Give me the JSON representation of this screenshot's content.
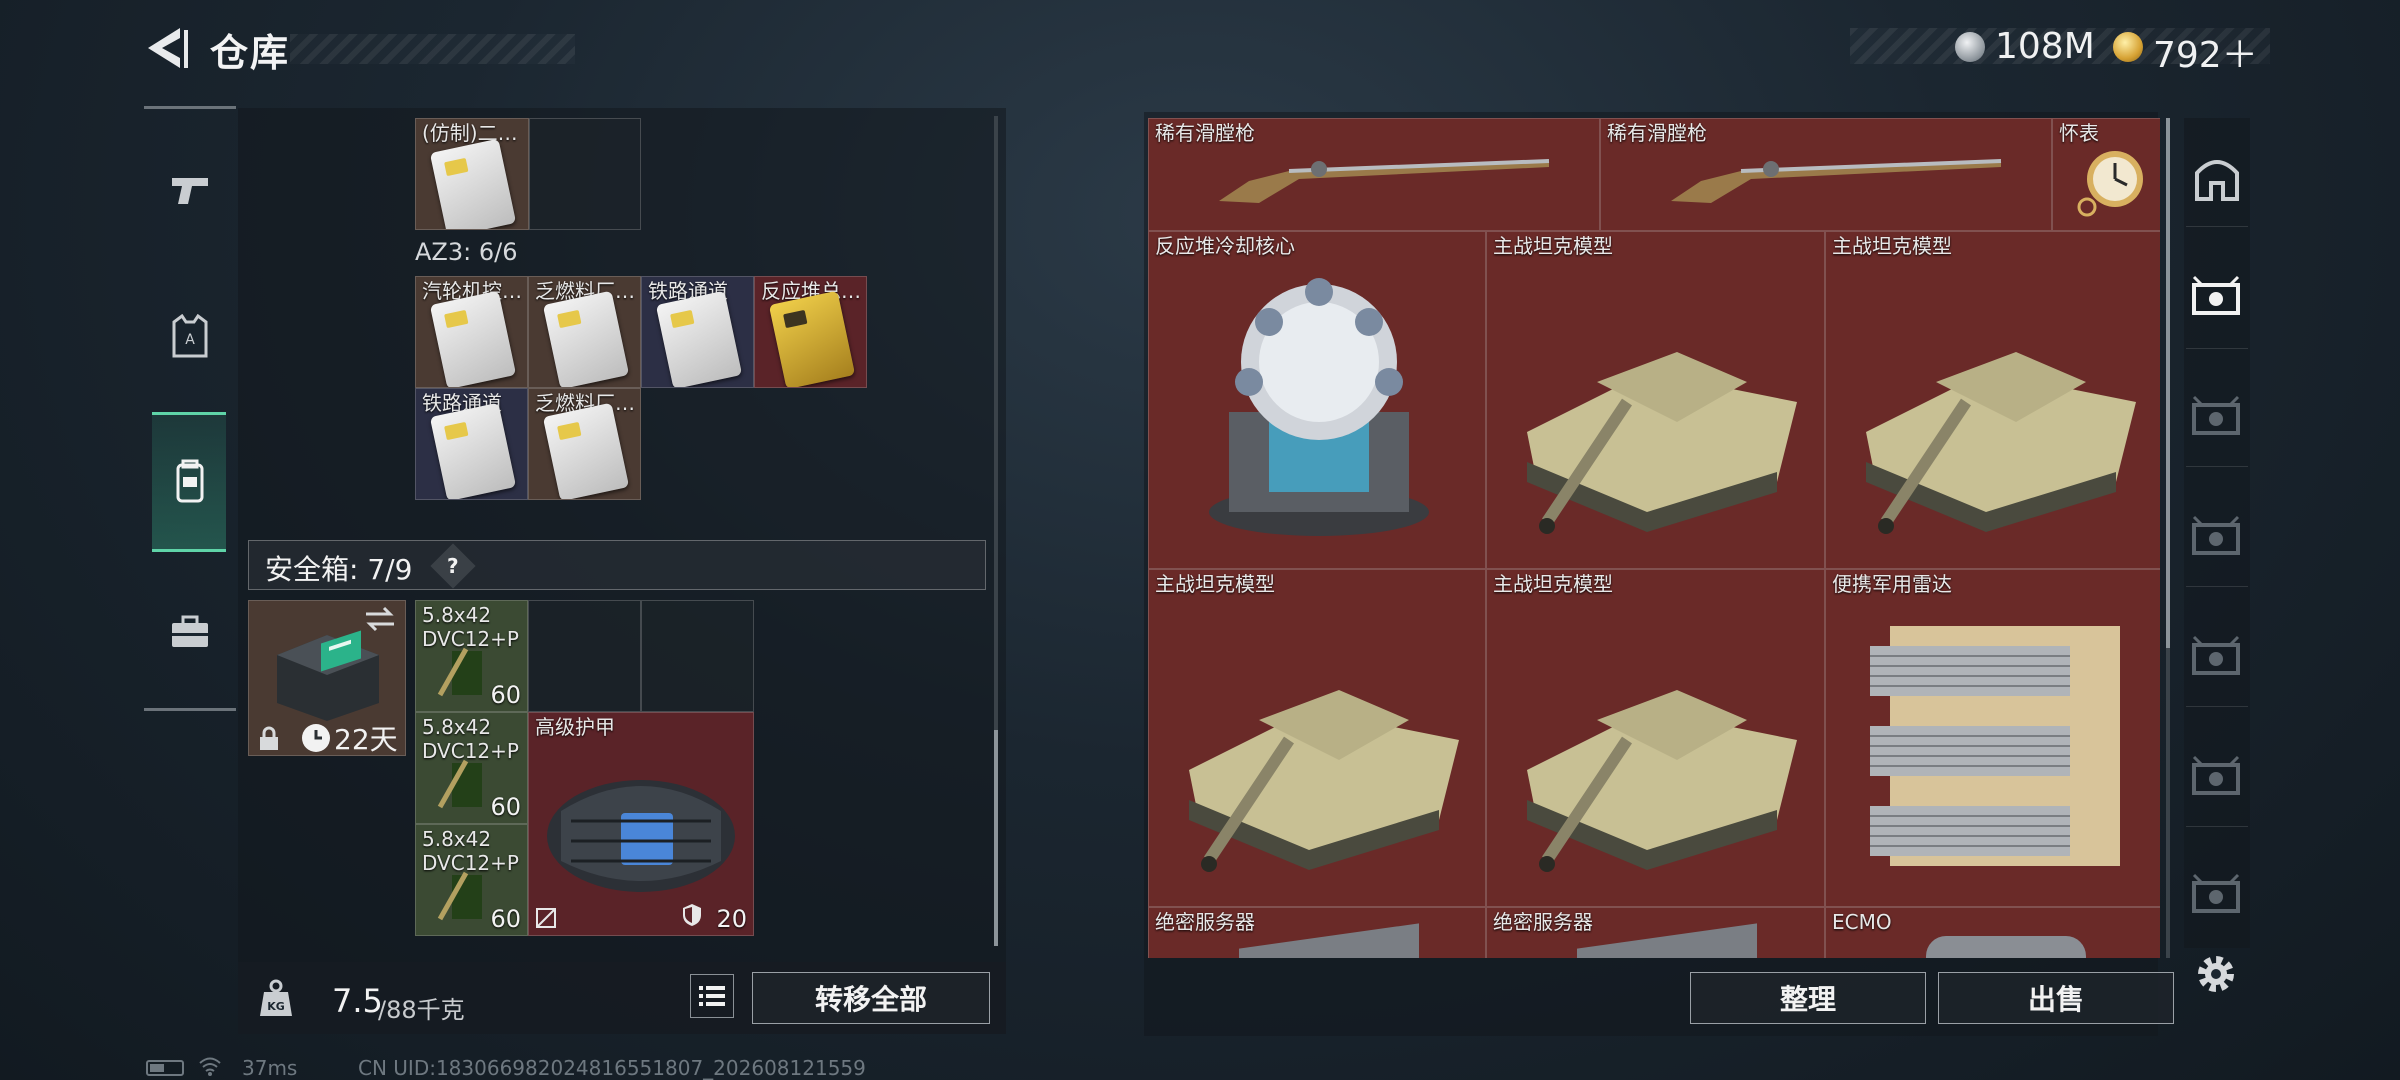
{
  "header": {
    "title": "仓库",
    "currency_silver": "108M",
    "currency_gold": "792＋"
  },
  "left_tabs": [
    "weapon-tab",
    "armor-tab",
    "backpack-tab",
    "toolbox-tab"
  ],
  "inventory": {
    "top_item_label": "(仿制)二…",
    "section_label": "AZ3: 6/6",
    "keycards": [
      {
        "label": "汽轮机控…",
        "color": "brown"
      },
      {
        "label": "乏燃料厂…",
        "color": "brown"
      },
      {
        "label": "铁路通道",
        "color": "navy"
      },
      {
        "label": "反应堆总…",
        "color": "maroon"
      },
      {
        "label": "铁路通道",
        "color": "navy"
      },
      {
        "label": "乏燃料厂…",
        "color": "brown"
      }
    ],
    "safebox": {
      "label": "安全箱: 7/9",
      "help": "?",
      "days": "22天",
      "ammo": [
        {
          "line1": "5.8x42",
          "line2": "DVC12+P",
          "count": "60"
        },
        {
          "line1": "5.8x42",
          "line2": "DVC12+P",
          "count": "60"
        },
        {
          "line1": "5.8x42",
          "line2": "DVC12+P",
          "count": "60"
        }
      ],
      "armor": {
        "label": "高级护甲",
        "durability": "20"
      }
    },
    "weight_current": "7.5",
    "weight_max": "/88千克",
    "transfer_all": "转移全部"
  },
  "storage": {
    "items": [
      {
        "label": "稀有滑膛枪"
      },
      {
        "label": "稀有滑膛枪"
      },
      {
        "label": "怀表"
      },
      {
        "label": "反应堆冷却核心"
      },
      {
        "label": "主战坦克模型"
      },
      {
        "label": "主战坦克模型"
      },
      {
        "label": "主战坦克模型"
      },
      {
        "label": "主战坦克模型"
      },
      {
        "label": "便携军用雷达"
      },
      {
        "label": "绝密服务器"
      },
      {
        "label": "绝密服务器"
      },
      {
        "label": "ECMO"
      }
    ],
    "sort_label": "整理",
    "sell_label": "出售"
  },
  "status": {
    "ping": "37ms",
    "uid": "CN UID:18306698202481655​1807_202608121559"
  },
  "colors": {
    "accent": "#5fd4a8",
    "storage_bg": "#5a2328"
  }
}
